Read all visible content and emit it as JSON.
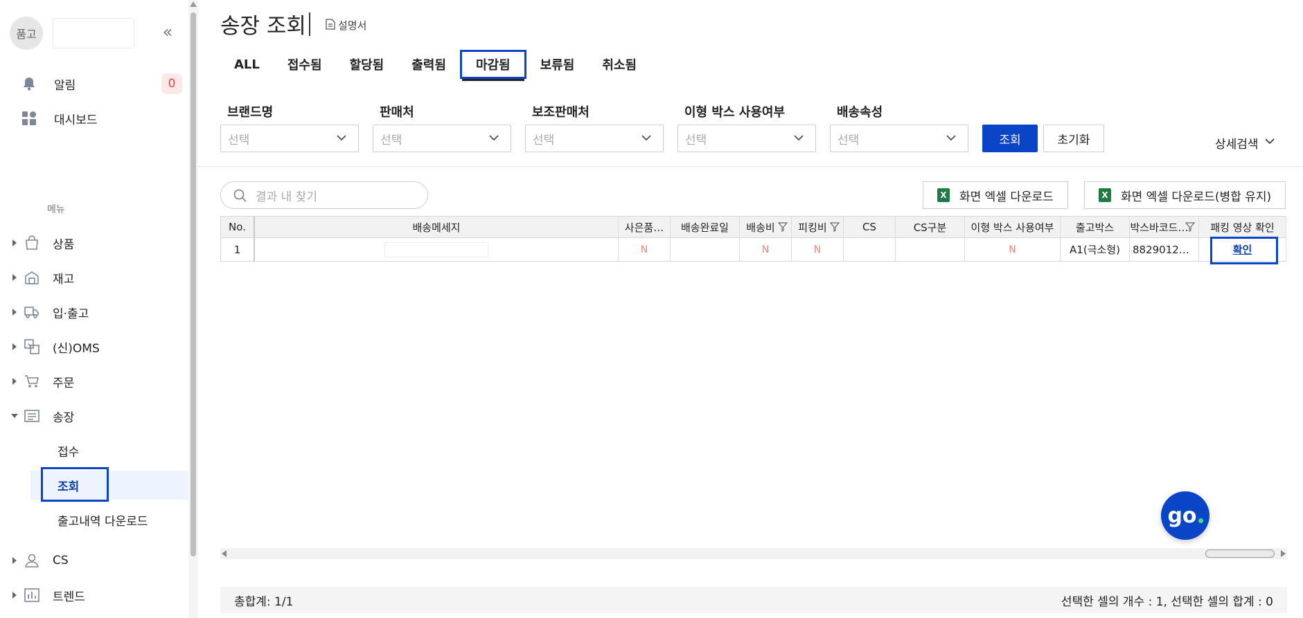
{
  "sidebar": {
    "org_initial": "품고",
    "notifications": {
      "label": "알림",
      "count": "0"
    },
    "dashboard": {
      "label": "대시보드"
    },
    "menu_header": "메뉴",
    "menu": [
      {
        "label": "상품",
        "icon": "bag-icon"
      },
      {
        "label": "재고",
        "icon": "warehouse-icon"
      },
      {
        "label": "입·출고",
        "icon": "truck-icon"
      },
      {
        "label": "(신)OMS",
        "icon": "transfer-icon"
      },
      {
        "label": "주문",
        "icon": "cart-icon"
      },
      {
        "label": "송장",
        "icon": "invoice-icon",
        "expanded": true
      },
      {
        "label": "CS",
        "icon": "person-icon"
      },
      {
        "label": "트렌드",
        "icon": "bar-chart-icon"
      }
    ],
    "invoice_sub": [
      {
        "label": "접수"
      },
      {
        "label": "조회",
        "active": true
      },
      {
        "label": "출고내역 다운로드"
      }
    ]
  },
  "header": {
    "title": "송장 조회",
    "manual_label": "설명서"
  },
  "tabs": [
    {
      "label": "ALL"
    },
    {
      "label": "접수됨"
    },
    {
      "label": "할당됨"
    },
    {
      "label": "출력됨"
    },
    {
      "label": "마감됨",
      "active": true
    },
    {
      "label": "보류됨"
    },
    {
      "label": "취소됨"
    }
  ],
  "filters": [
    {
      "label": "브랜드명",
      "placeholder": "선택"
    },
    {
      "label": "판매처",
      "placeholder": "선택"
    },
    {
      "label": "보조판매처",
      "placeholder": "선택"
    },
    {
      "label": "이형 박스 사용여부",
      "placeholder": "선택"
    },
    {
      "label": "배송속성",
      "placeholder": "선택"
    }
  ],
  "actions": {
    "search_label": "조회",
    "reset_label": "초기화",
    "advanced_label": "상세검색"
  },
  "results": {
    "find_placeholder": "결과 내 찾기",
    "excel_download_label": "화면 엑셀 다운로드",
    "excel_download_merge_label": "화면 엑셀 다운로드(병합 유지)"
  },
  "grid": {
    "columns": [
      "No.",
      "배송메세지",
      "사은품…",
      "배송완료일",
      "배송비",
      "피킹비",
      "CS",
      "CS구분",
      "이형 박스 사용여부",
      "출고박스",
      "박스바코드…",
      "패킹 영상 확인"
    ],
    "rows": [
      [
        "1",
        "",
        "N",
        "",
        "N",
        "N",
        "",
        "",
        "N",
        "A1(극소형)",
        "8829012…",
        "확인"
      ]
    ]
  },
  "footer": {
    "total": "총합계: 1/1",
    "selection": "선택한 셀의 개수 : 1, 선택한 셀의 합계 : 0"
  },
  "colors": {
    "primary": "#0b45c7",
    "badge_bg": "#fde8e8",
    "badge_text": "#e04747",
    "flag_n": "#f08080"
  }
}
